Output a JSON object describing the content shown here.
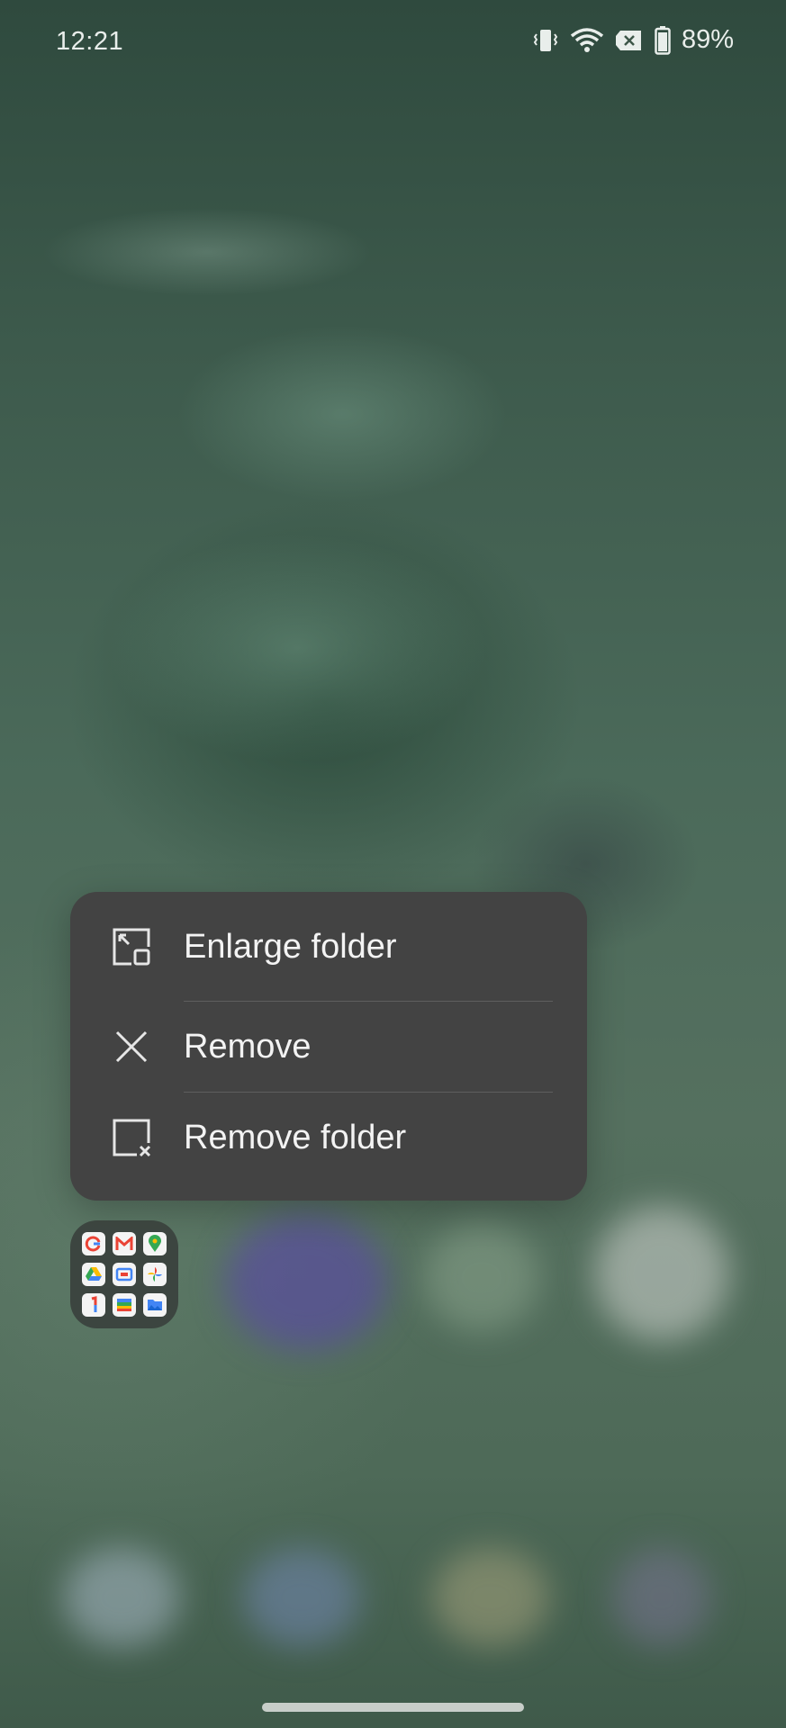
{
  "status_bar": {
    "time": "12:21",
    "battery_percent": "89%",
    "icons": [
      "vibrate-icon",
      "wifi-icon",
      "no-sim-icon",
      "battery-icon"
    ]
  },
  "context_menu": {
    "items": [
      {
        "label": "Enlarge folder",
        "icon": "enlarge-folder-icon"
      },
      {
        "label": "Remove",
        "icon": "close-icon"
      },
      {
        "label": "Remove folder",
        "icon": "remove-folder-icon"
      }
    ]
  },
  "folder": {
    "apps": [
      "google-icon",
      "gmail-icon",
      "maps-icon",
      "drive-icon",
      "meet-icon",
      "photos-icon",
      "one-icon",
      "wallet-icon",
      "files-icon"
    ]
  },
  "colors": {
    "menu_background": "#434343",
    "menu_text": "#f3f3f3",
    "divider": "#5e5e5e"
  }
}
